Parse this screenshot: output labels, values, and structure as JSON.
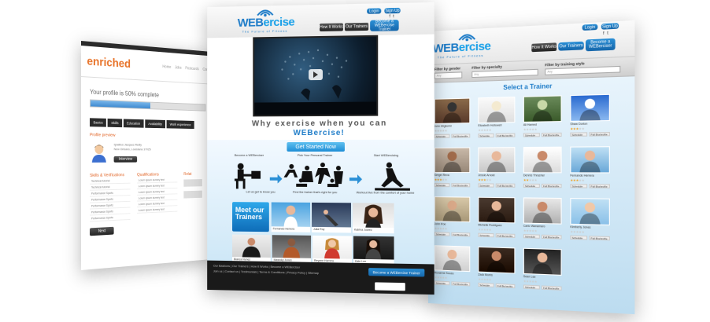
{
  "left_page": {
    "logo": "enriched",
    "nav": [
      "Home",
      "Jobs",
      "Postcards",
      "Con"
    ],
    "progress_text": "Your profile is 50% complete",
    "progress": 0.5,
    "tabs": [
      "Basics",
      "Skills",
      "Education",
      "Availability",
      "Work experience"
    ],
    "profile_preview_label": "Profile preview",
    "profile_lines": [
      "Ignatius Jacques Reilly",
      "New Orleans, Louisiana 17025"
    ],
    "interview_btn": "Interview",
    "skills_label": "Skills & Verifications",
    "qualifications_label": "Qualifications",
    "third_col_label": "Relat",
    "skills_rows": [
      "Technical tutorial",
      "Technical tutorial",
      "Performance Sports",
      "Performance Sports",
      "Performance Sports",
      "Performance Sports",
      "Performance Sports"
    ],
    "qual_rows": [
      "Lorem Ipsum dummy text",
      "Lorem Ipsum dummy text",
      "Lorem Ipsum dummy text",
      "Lorem Ipsum dummy text",
      "Lorem Ipsum dummy text",
      "Lorem Ipsum dummy text"
    ],
    "next_btn": "Next"
  },
  "center_page": {
    "logo_main": "WEB",
    "logo_accent": "ercise",
    "tagline": "The Future of Fitness",
    "login": "Login",
    "signup": "Sign Up",
    "nav": [
      "How It Works",
      "Our Trainers",
      "Become a WEBercise Trainer"
    ],
    "why_line1": "Why exercise when you can",
    "why_line2": "WEBercise!",
    "get_started": "Get Started Now",
    "steps": [
      {
        "title": "Become a WEBerciser",
        "sub": "Let us get to know you"
      },
      {
        "title": "Pick Your Personal Trainer",
        "sub": "Find the trainer that's right for you"
      },
      {
        "title": "Start WEBercising",
        "sub": "Workout live from the comfort of your home"
      }
    ],
    "meet": "Meet our Trainers",
    "trainers_row1": [
      "Fernando Herrera",
      "Julia Roy",
      "Katrina Juarez"
    ],
    "trainers_row2": [
      "Bianca Nunez",
      "Mastoky Jones",
      "Reyane Horrera",
      "Kate Lee"
    ],
    "footer_links": "Our Bastions | Our Trainers | How It Works | Become a WEBerciser",
    "footer_links2": "Join us | Contact us | Testimonials | Terms & Conditions | Privacy Policy | Sitemap",
    "become_trainer": "Become a WEBercise Trainer"
  },
  "right_page": {
    "logo_main": "WEB",
    "logo_accent": "ercise",
    "tagline": "The Future of Fitness",
    "login": "Login",
    "signup": "Sign Up",
    "nav": [
      "How It Works",
      "Our Trainers",
      "Become a WEBerciser"
    ],
    "filter_gender": "Filter by gender",
    "filter_specialty": "Filter by specialty",
    "filter_style": "Filter by training style",
    "select_any": "Any",
    "select_title": "Select a Trainer",
    "trainers": [
      {
        "name": "John Migliorini",
        "stars": 0
      },
      {
        "name": "Elizabeth Hollowell",
        "stars": 0
      },
      {
        "name": "Ali Hamed",
        "stars": 0
      },
      {
        "name": "Shaw Dorion",
        "stars": 3
      },
      {
        "name": "Sergei Reva",
        "stars": 3
      },
      {
        "name": "Jessie Arnold",
        "stars": 3
      },
      {
        "name": "Dennis Thrasher",
        "stars": 2
      },
      {
        "name": "Fernando Herrera",
        "stars": 3
      },
      {
        "name": "John Roe",
        "stars": 0
      },
      {
        "name": "Michelle Rodriguez",
        "stars": 0
      },
      {
        "name": "Carlo Wanamaro",
        "stars": 0
      },
      {
        "name": "Kimberly Jones",
        "stars": 0
      },
      {
        "name": "Roxanne Souza",
        "stars": 0
      },
      {
        "name": "Zack Morris",
        "stars": 0
      },
      {
        "name": "Sean Lee",
        "stars": 0
      }
    ],
    "btn_schedule": "Schedule",
    "btn_profile": "Full Bio/profile"
  }
}
